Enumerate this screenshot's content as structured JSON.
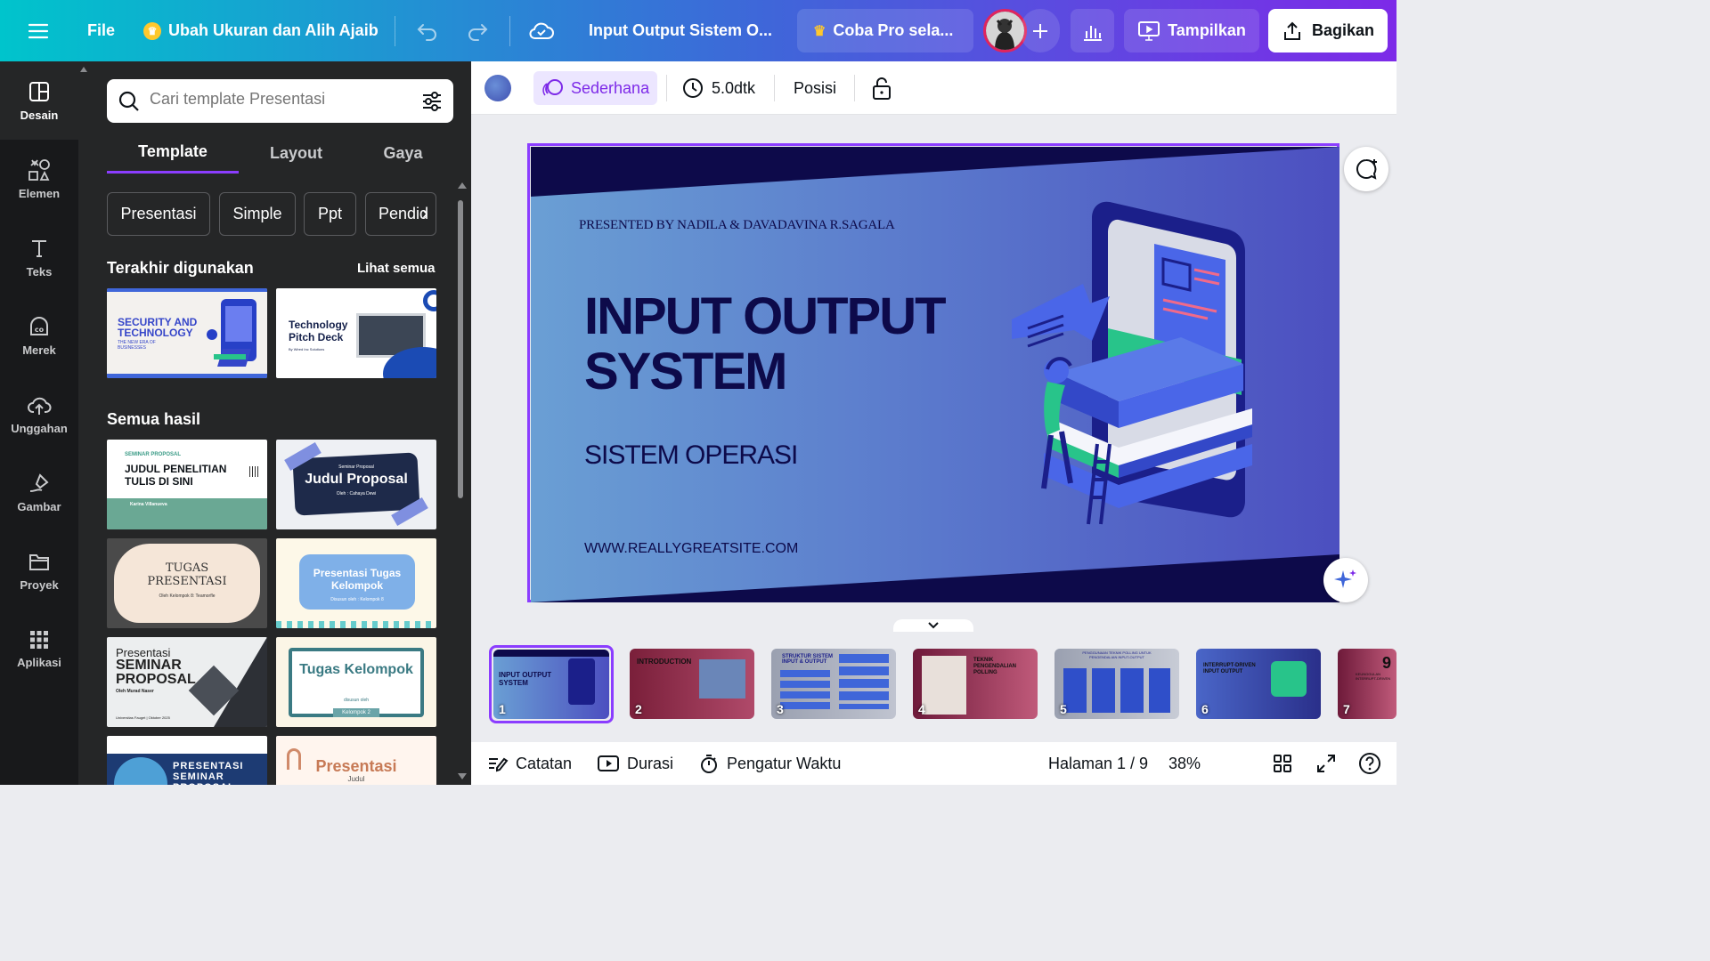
{
  "topbar": {
    "file": "File",
    "promo": "Ubah Ukuran dan Alih Ajaib",
    "doc_title": "Input Output Sistem O...",
    "pro_trial": "Coba Pro sela...",
    "present": "Tampilkan",
    "share": "Bagikan"
  },
  "rail": {
    "items": [
      {
        "label": "Desain"
      },
      {
        "label": "Elemen"
      },
      {
        "label": "Teks"
      },
      {
        "label": "Merek"
      },
      {
        "label": "Unggahan"
      },
      {
        "label": "Gambar"
      },
      {
        "label": "Proyek"
      },
      {
        "label": "Aplikasi"
      }
    ]
  },
  "panel": {
    "search_placeholder": "Cari template Presentasi",
    "tabs": [
      "Template",
      "Layout",
      "Gaya"
    ],
    "chips": [
      "Presentasi",
      "Simple",
      "Ppt",
      "Pendid"
    ],
    "recent_title": "Terakhir digunakan",
    "see_all": "Lihat semua",
    "all_results_title": "Semua hasil",
    "recent": [
      {
        "title": "SECURITY AND TECHNOLOGY",
        "sub": "THE NEW ERA OF BUSINESSES"
      },
      {
        "title": "Technology Pitch Deck",
        "sub": "By Wired Inc Solutions"
      }
    ],
    "results": [
      {
        "kicker": "SEMINAR PROPOSAL",
        "title": "JUDUL PENELITIAN TULIS DI SINI",
        "sub": "Karina Villanueva"
      },
      {
        "kicker": "Seminar Proposal",
        "title": "Judul Proposal",
        "sub": "Oleh : Cahaya Dewi"
      },
      {
        "title": "TUGAS PRESENTASI",
        "sub": "Oleh Kelompok 8: Teamorfle"
      },
      {
        "title": "Presentasi Tugas Kelompok",
        "sub": "Disusun oleh : Kelompok 8"
      },
      {
        "kicker": "Presentasi",
        "title": "SEMINAR PROPOSAL",
        "sub": "Oleh Murad Naser",
        "foot": "Universitas Fauget | Oktober 2025"
      },
      {
        "title": "Tugas Kelompok",
        "sub": "disusun oleh",
        "tag": "Kelompok 2"
      },
      {
        "title": "PRESENTASI SEMINAR PROPOSAL"
      },
      {
        "title": "Presentasi",
        "sub": "Judul"
      }
    ]
  },
  "subbar": {
    "animation": "Sederhana",
    "duration": "5.0dtk",
    "position": "Posisi"
  },
  "slide": {
    "presented_by": "PRESENTED BY NADILA & DAVADAVINA R.SAGALA",
    "title_line1": "INPUT OUTPUT",
    "title_line2": "SYSTEM",
    "subtitle": "SISTEM OPERASI",
    "website": "WWW.REALLYGREATSITE.COM"
  },
  "pages": [
    {
      "num": "1",
      "caption": "INPUT OUTPUT SYSTEM"
    },
    {
      "num": "2",
      "caption": "INTRODUCTION"
    },
    {
      "num": "3",
      "caption": "STRUKTUR SISTEM INPUT & OUTPUT"
    },
    {
      "num": "4",
      "caption": "TEKNIK PENGENDALIAN POLLING"
    },
    {
      "num": "5",
      "caption": "PENGGUNAAN TEKNIK POLLING UNTUK PENGENDALIAN INPUT-OUTPUT"
    },
    {
      "num": "6",
      "caption": "INTERRUPT-DRIVEN INPUT OUTPUT"
    },
    {
      "num": "7",
      "caption": "KEUNGGULAN INTERRUPT-DRIVEN"
    }
  ],
  "footer": {
    "notes": "Catatan",
    "duration": "Durasi",
    "timer": "Pengatur Waktu",
    "page_indicator": "Halaman 1 / 9",
    "zoom": "38%"
  },
  "colors": {
    "accent": "#8b3dff",
    "slide_navy": "#0d0a4a",
    "rail_bg": "#18191b",
    "panel_bg": "#252627"
  }
}
